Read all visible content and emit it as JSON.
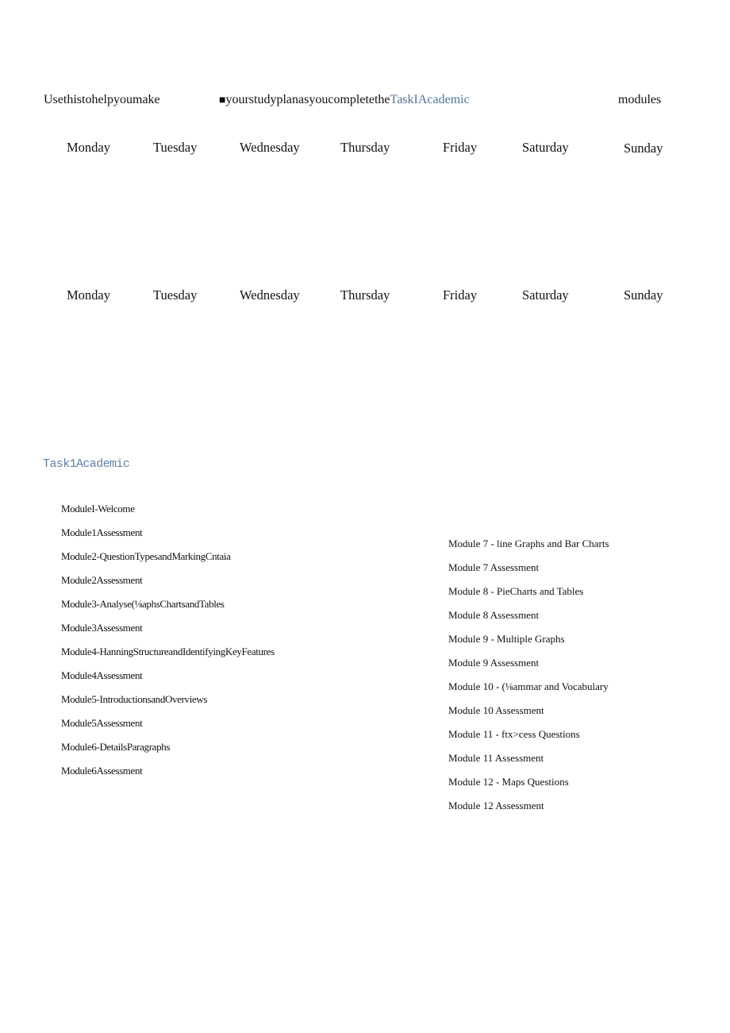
{
  "intro": {
    "part1": "Usethistohelpyoumake",
    "bullet": "■",
    "part2": "yourstudyplanasyoucompletethe",
    "course_link": "TaskIAcademic",
    "part3": "modules",
    "accent_color": "#4f7399"
  },
  "week1": {
    "days": [
      "Monday",
      "Tuesday",
      "Wednesday",
      "Thursday",
      "Friday",
      "Saturday",
      "Sunday"
    ]
  },
  "week2": {
    "days": [
      "Monday",
      "Tuesday",
      "Wednesday",
      "Thursday",
      "Friday",
      "Saturday",
      "Sunday"
    ]
  },
  "modules_section": {
    "title": "Task1Academic",
    "left_column": [
      "ModuleI-Welcome",
      "Module1Assessment",
      "Module2-QuestionTypesandMarkingCntaia",
      "Module2Assessment",
      "Module3-Analyse(⅛aphsChartsandTables",
      "Module3Assessment",
      "Module4-HanningStructureandIdentifyingKeyFeatures",
      "Module4Assessment",
      "Module5-IntroductionsandOverviews",
      "Module5Assessment",
      "Module6-DetailsParagraphs",
      "Module6Assessment"
    ],
    "right_column": [
      "Module 7 - line Graphs and Bar Charts",
      "Module 7 Assessment",
      "Module 8 - PieCharts and Tables",
      "Module 8 Assessment",
      "Module 9 - Multiple Graphs",
      "Module 9 Assessment",
      "Module 10 - (⅛ammar and Vocabulary",
      "Module 10 Assessment",
      "Module 11 - ftx>cess Questions",
      "Module 11 Assessment",
      "Module 12 - Maps Questions",
      "Module 12 Assessment"
    ]
  }
}
